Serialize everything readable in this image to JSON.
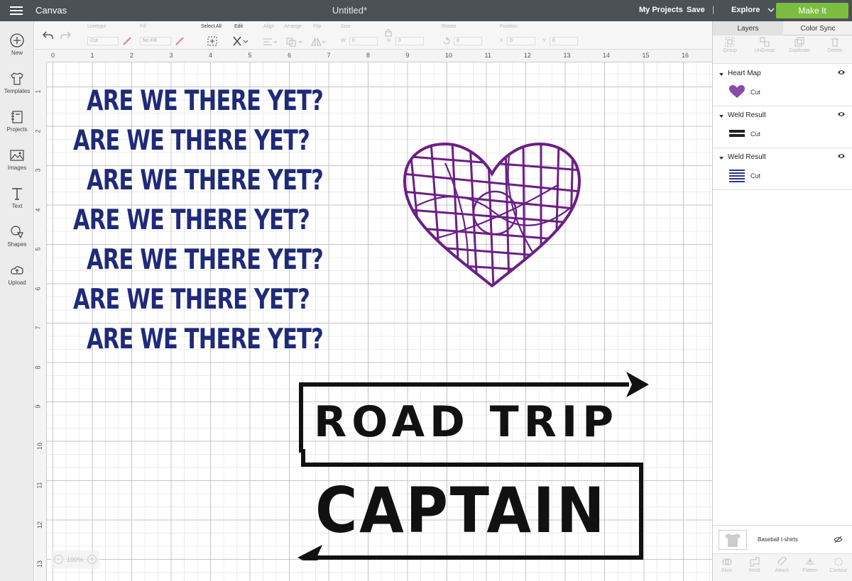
{
  "header": {
    "app_name": "Canvas",
    "document_title": "Untitled*",
    "my_projects": "My Projects",
    "save": "Save",
    "separator": "|",
    "explore": "Explore",
    "make_it": "Make It"
  },
  "sidebar": {
    "items": [
      {
        "label": "New",
        "icon": "plus-circle-icon"
      },
      {
        "label": "Templates",
        "icon": "tshirt-icon"
      },
      {
        "label": "Projects",
        "icon": "notebook-icon"
      },
      {
        "label": "Images",
        "icon": "image-icon"
      },
      {
        "label": "Text",
        "icon": "text-icon"
      },
      {
        "label": "Shapes",
        "icon": "shapes-icon"
      },
      {
        "label": "Upload",
        "icon": "cloud-upload-icon"
      }
    ]
  },
  "toolbar": {
    "linetype_label": "Linetype",
    "linetype_value": "Cut",
    "fill_label": "Fill",
    "fill_value": "No Fill",
    "select_all": "Select All",
    "edit": "Edit",
    "align": "Align",
    "arrange": "Arrange",
    "flip": "Flip",
    "size": "Size",
    "width_prefix": "W",
    "width_value": "0",
    "height_prefix": "H",
    "height_value": "0",
    "rotate": "Rotate",
    "rotate_value": "0",
    "position": "Position",
    "x_prefix": "X",
    "x_value": "0",
    "y_prefix": "Y",
    "y_value": "0"
  },
  "ruler": {
    "top": [
      "0",
      "1",
      "2",
      "3",
      "4",
      "5",
      "6",
      "7",
      "8",
      "9",
      "10",
      "11",
      "12",
      "13",
      "14",
      "15",
      "16"
    ],
    "left": [
      "1",
      "2",
      "3",
      "4",
      "5",
      "6",
      "7",
      "8",
      "9",
      "10",
      "11",
      "12",
      "13"
    ]
  },
  "canvas": {
    "text_lines": [
      "ARE WE THERE YET?",
      "ARE WE THERE YET?",
      "ARE WE THERE YET?",
      "ARE WE THERE YET?",
      "ARE WE THERE YET?",
      "ARE WE THERE YET?",
      "ARE WE THERE YET?"
    ],
    "road_trip_line1": "ROAD TRIP",
    "road_trip_line2": "CAPTAIN",
    "zoom": "100%",
    "colors": {
      "text_navy": "#1f2a78",
      "heart_purple": "#6b1f86",
      "black": "#111111"
    }
  },
  "panel": {
    "tabs": [
      "Layers",
      "Color Sync"
    ],
    "actions": [
      "Group",
      "UnGroup",
      "Duplicate",
      "Delete"
    ],
    "layers": [
      {
        "name": "Heart Map",
        "op": "Cut"
      },
      {
        "name": "Weld Result",
        "op": "Cut"
      },
      {
        "name": "Weld Result",
        "op": "Cut"
      }
    ],
    "mat_label": "Baseball t-shirts",
    "bottom_actions": [
      "Slice",
      "Weld",
      "Attach",
      "Flatten",
      "Contour"
    ]
  }
}
